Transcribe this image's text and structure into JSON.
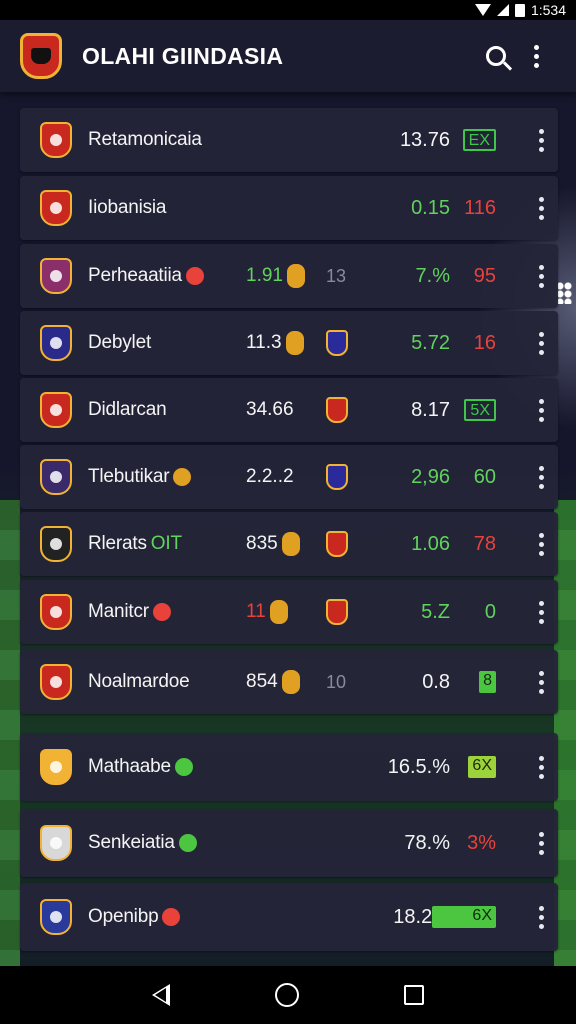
{
  "status_bar": {
    "time": "1:534"
  },
  "app_bar": {
    "title": "OLAHI GIINDASIA"
  },
  "colors": {
    "background": "#14142a",
    "row": "#242438",
    "accent_green": "#5fd35b",
    "accent_red": "#e8423b",
    "crest_gold": "#f2b233"
  },
  "rows": [
    {
      "team": "Retamonicaia",
      "crest_color": "#c8281e",
      "mid_a": "",
      "mid_b": "",
      "value": "13.76",
      "value_color": "white",
      "badge": "EX",
      "badge_style": "outline"
    },
    {
      "team": "Iiobanisia",
      "crest_color": "#c8281e",
      "mid_a": "",
      "mid_b": "",
      "value": "0.15",
      "value_color": "green",
      "badge": "116",
      "badge_style": "red-text"
    },
    {
      "team": "Perheaatiia",
      "crest_color": "#8a2f6a",
      "mid_a": "1.91",
      "mid_b": "13",
      "value": "7.%",
      "value_color": "green",
      "badge": "95",
      "badge_style": "red-text"
    },
    {
      "team": "Debylet",
      "crest_color": "#2a2a8a",
      "mid_a": "11.3",
      "mid_b": "",
      "value": "5.72",
      "value_color": "green",
      "badge": "16",
      "badge_style": "red-text"
    },
    {
      "team": "Didlarcan",
      "crest_color": "#c8281e",
      "mid_a": "34.66",
      "mid_b": "",
      "value": "8.17",
      "value_color": "white",
      "badge": "5X",
      "badge_style": "outline"
    },
    {
      "team": "Tlebutikar",
      "crest_color": "#3a2a6a",
      "mid_a": "2.2..2",
      "mid_b": "",
      "value": "2,96",
      "value_color": "green",
      "badge": "60",
      "badge_style": "green-text"
    },
    {
      "team": "Rlerats",
      "team_suffix": "OIT",
      "crest_color": "#222",
      "mid_a": "835",
      "mid_b": "",
      "value": "1.06",
      "value_color": "green",
      "badge": "78",
      "badge_style": "red-text"
    },
    {
      "team": "Manitcr",
      "crest_color": "#c8281e",
      "mid_a": "11",
      "mid_b": "",
      "value": "5.Z",
      "value_color": "green",
      "badge": "0",
      "badge_style": "green-text"
    },
    {
      "team": "Noalmardoe",
      "crest_color": "#c8281e",
      "mid_a": "854",
      "mid_b": "10",
      "value": "0.8",
      "value_color": "white",
      "badge": "8",
      "badge_style": "fill"
    },
    {
      "team": "Mathaabe",
      "crest_color": "#f2b233",
      "mid_a": "",
      "mid_b": "",
      "value": "16.5.%",
      "value_color": "white",
      "badge": "6X",
      "badge_style": "fill-lime"
    },
    {
      "team": "Senkeiatia",
      "crest_color": "#d8d8d8",
      "mid_a": "",
      "mid_b": "",
      "value": "78.%",
      "value_color": "white",
      "badge": "3%",
      "badge_style": "red-text"
    },
    {
      "team": "Openibp",
      "crest_color": "#2a3a9a",
      "mid_a": "",
      "mid_b": "",
      "value": "18.2%",
      "value_color": "white",
      "badge": "6X",
      "badge_style": "fill-wide"
    }
  ]
}
